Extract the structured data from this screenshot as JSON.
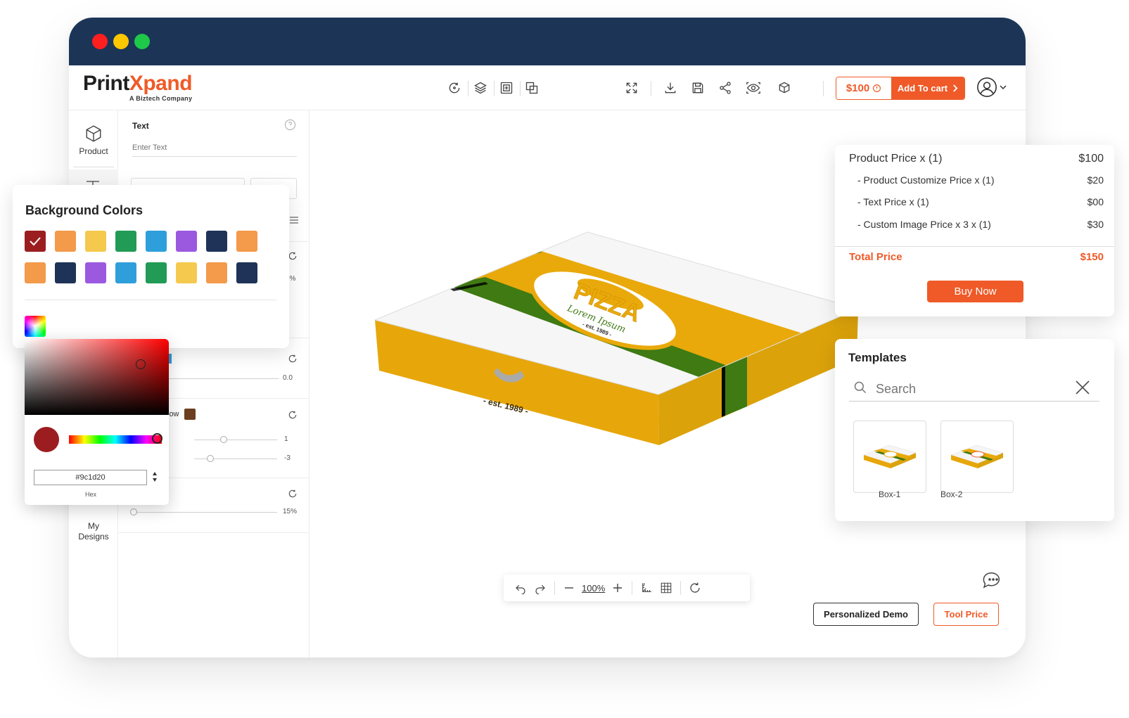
{
  "window": {
    "controls": [
      "close",
      "minimize",
      "maximize"
    ],
    "colors": {
      "close": "#ff1f1f",
      "minimize": "#ffc700",
      "maximize": "#1ec94a",
      "titlebar": "#1c3557",
      "accent": "#ef5a28"
    }
  },
  "brand": {
    "name_part1": "Print",
    "name_part2": "Xpand",
    "tagline": "A Biztech Company"
  },
  "toolbar": {
    "icons": [
      "reset-icon",
      "layers-icon",
      "mockup-icon",
      "duplicate-icon",
      "fullscreen-icon",
      "download-icon",
      "save-icon",
      "share-icon",
      "preview-icon",
      "3d-view-icon"
    ],
    "price": "$100",
    "add_to_cart": "Add To cart"
  },
  "rail": {
    "product_label": "Product",
    "my_designs_label": "My\nDesigns"
  },
  "text_panel": {
    "heading": "Text",
    "input_placeholder": "Enter Text"
  },
  "panel_values": {
    "opacity_fragment": "5%",
    "spacing": "0.0",
    "shadow_fragment": "low",
    "shadow_blur": "1",
    "shadow_offset": "-3",
    "transparency": "15%"
  },
  "background_colors": {
    "title": "Background Colors",
    "swatches_row1": [
      "#9c1d20",
      "#f39a4b",
      "#f4c94e",
      "#219b56",
      "#2f9fdc",
      "#9b59e0",
      "#1e3357",
      "#f39a4b"
    ],
    "swatches_row2": [
      "#f39a4b",
      "#1e3357",
      "#9b59e0",
      "#2f9fdc",
      "#219b56",
      "#f4c94e",
      "#f39a4b",
      "#1e3357"
    ],
    "selected_index": 0
  },
  "color_picker": {
    "hex_value": "#9c1d20",
    "hex_label": "Hex",
    "current_color": "#9c1d20"
  },
  "canvas": {
    "box_text_top": "PIZZA",
    "box_text_script": "Lorem Ipsum",
    "box_text_est": "- est. 1989 -",
    "box_text_front": "- est. 1989 -",
    "zoom": "100%"
  },
  "pricing": {
    "rows": [
      {
        "label": "Product Price  x  (1)",
        "value": "$100"
      },
      {
        "label": "- Product Customize Price  x  (1)",
        "value": "$20"
      },
      {
        "label": "- Text Price x (1)",
        "value": "$00"
      },
      {
        "label": "- Custom Image Price x 3 x  (1)",
        "value": "$30"
      }
    ],
    "total_label": "Total Price",
    "total_value": "$150",
    "buy_now": "Buy Now"
  },
  "templates": {
    "title": "Templates",
    "search_placeholder": "Search",
    "items": [
      {
        "label": "Box-1"
      },
      {
        "label": "Box-2"
      }
    ]
  },
  "footer_buttons": {
    "personalized_demo": "Personalized Demo",
    "tool_price": "Tool Price"
  }
}
